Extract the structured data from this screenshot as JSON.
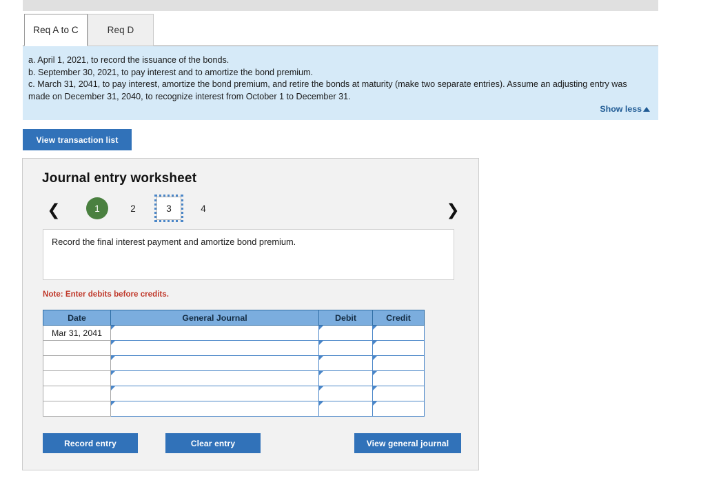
{
  "top_bar": {
    "label": "toolbar-strip"
  },
  "tabs": [
    {
      "label": "Req A to C",
      "active": true
    },
    {
      "label": "Req D",
      "active": false
    }
  ],
  "instructions": {
    "lines": [
      "a. April 1, 2021, to record the issuance of the bonds.",
      "b. September 30, 2021, to pay interest and to amortize the bond premium.",
      "c. March 31, 2041, to pay interest, amortize the bond premium, and retire the bonds at maturity (make two separate entries).  Assume an adjusting entry was made on December 31, 2040, to recognize interest from October 1 to December 31."
    ],
    "show_less_label": "Show less",
    "show_less_icon": "caret-up-icon",
    "background": "#d6eaf8"
  },
  "view_transaction_list_label": "View transaction list",
  "worksheet": {
    "title": "Journal entry worksheet",
    "pager": {
      "prev_icon": "chevron-left-icon",
      "next_icon": "chevron-right-icon",
      "pages": [
        {
          "number": "1",
          "state": "completed"
        },
        {
          "number": "2",
          "state": "default"
        },
        {
          "number": "3",
          "state": "focused"
        },
        {
          "number": "4",
          "state": "default"
        }
      ],
      "completed_color": "#4a8040",
      "focus_color": "#4a86c8"
    },
    "prompt": "Record the final interest payment and amortize bond premium.",
    "note": "Note: Enter debits before credits.",
    "note_color": "#c0392b",
    "table": {
      "header_color": "#7badde",
      "columns": [
        "Date",
        "General Journal",
        "Debit",
        "Credit"
      ],
      "rows": [
        {
          "date": "Mar 31, 2041",
          "general_journal": "",
          "debit": "",
          "credit": ""
        },
        {
          "date": "",
          "general_journal": "",
          "debit": "",
          "credit": ""
        },
        {
          "date": "",
          "general_journal": "",
          "debit": "",
          "credit": ""
        },
        {
          "date": "",
          "general_journal": "",
          "debit": "",
          "credit": ""
        },
        {
          "date": "",
          "general_journal": "",
          "debit": "",
          "credit": ""
        },
        {
          "date": "",
          "general_journal": "",
          "debit": "",
          "credit": ""
        }
      ]
    },
    "buttons": {
      "record_entry": "Record entry",
      "clear_entry": "Clear entry",
      "view_general_journal": "View general journal",
      "color": "#3172b9"
    }
  }
}
